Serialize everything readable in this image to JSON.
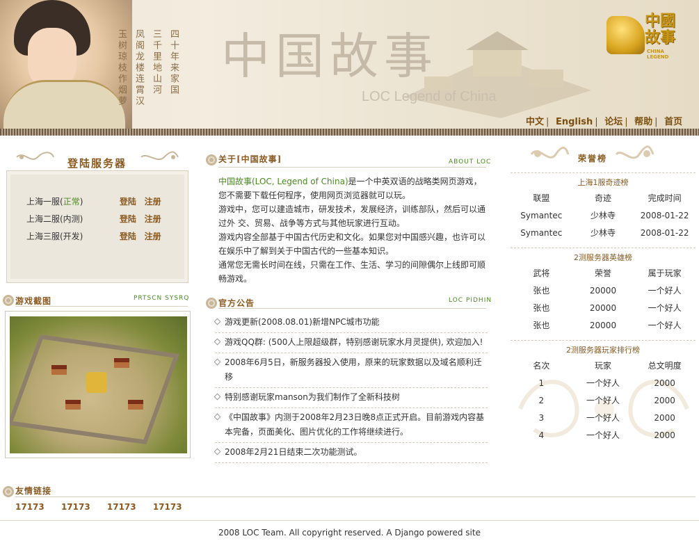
{
  "header": {
    "big_title": "中国故事",
    "sub_title": "LOC Legend of China",
    "poem": [
      "四十年来家国",
      "三千里地山河",
      "凤阁龙楼连霄汉",
      "玉树琼枝作烟萝"
    ],
    "logo_text": "中國故事",
    "logo_small": "CHINA LEGEND",
    "nav": [
      "中文",
      "English",
      "论坛",
      "帮助",
      "首页"
    ]
  },
  "login": {
    "title": "登陆服务器",
    "servers": [
      {
        "name_prefix": "上海一服(",
        "status": "正常",
        "name_suffix": ")",
        "login": "登陆",
        "register": "注册"
      },
      {
        "name": "上海二服(内测)",
        "login": "登陆",
        "register": "注册"
      },
      {
        "name": "上海三服(开发)",
        "login": "登陆",
        "register": "注册"
      }
    ]
  },
  "screenshot_section": {
    "title": "游戏截图",
    "sub": "PRTSCN SYSRQ"
  },
  "friends": {
    "title": "友情链接",
    "links": [
      "17173",
      "17173",
      "17173",
      "17173"
    ]
  },
  "about": {
    "title": "关于[中国故事]",
    "sub": "ABOUT LOC",
    "lead_green": "中国故事(LOC, Legend of China)",
    "lead_rest": "是一个中英双语的战略类网页游戏，您不需要下载任何程序，使用网页浏览器就可以玩。",
    "p2": "游戏中，您可以建造城市，研发技术，发展经济，训练部队，然后可以通过外 交、贸易、战争等方式与其他玩家进行互动。",
    "p3": "游戏内容全部基于中国古代历史和文化。如果您对中国感兴趣，也许可以 在娱乐中了解到关于中国古代的一些基本知识。",
    "p4": "通常您无需长时间在线，只需在工作、生活、学习的间隙偶尔上线即可顺 畅游戏。"
  },
  "news": {
    "title": "官方公告",
    "sub": "LOC PIDHIN",
    "items": [
      "游戏更新(2008.08.01)新增NPC城市功能",
      "游戏QQ群: (500人上限超级群，特别感谢玩家水月灵提供), 欢迎加入!",
      "2008年6月5日，新服务器投入使用，原来的玩家数据以及域名顺利迁移",
      "特别感谢玩家manson为我们制作了全新科技树",
      "《中国故事》内测于2008年2月23日晚8点正式开启。目前游戏内容基本完备，页面美化、图片优化的工作将继续进行。",
      "2008年2月21日结束二次功能测试。"
    ]
  },
  "honor": {
    "title": "荣誉榜",
    "wonders": {
      "title": "上海1服奇迹榜",
      "headers": [
        "联盟",
        "奇迹",
        "完成时间"
      ],
      "rows": [
        [
          "Symantec",
          "少林寺",
          "2008-01-22"
        ],
        [
          "Symantec",
          "少林寺",
          "2008-01-22"
        ]
      ]
    },
    "heroes": {
      "title": "2测服务器英雄榜",
      "headers": [
        "武将",
        "荣誉",
        "属于玩家"
      ],
      "rows": [
        [
          "张也",
          "20000",
          "一个好人"
        ],
        [
          "张也",
          "20000",
          "一个好人"
        ],
        [
          "张也",
          "20000",
          "一个好人"
        ]
      ]
    },
    "players": {
      "title": "2测服务器玩家排行榜",
      "headers": [
        "名次",
        "玩家",
        "总文明度"
      ],
      "rows": [
        [
          "1",
          "一个好人",
          "2000"
        ],
        [
          "2",
          "一个好人",
          "2000"
        ],
        [
          "3",
          "一个好人",
          "2000"
        ],
        [
          "4",
          "一个好人",
          "2000"
        ]
      ]
    }
  },
  "footer": "2008 LOC Team. All copyright reserved. A Django powered site"
}
